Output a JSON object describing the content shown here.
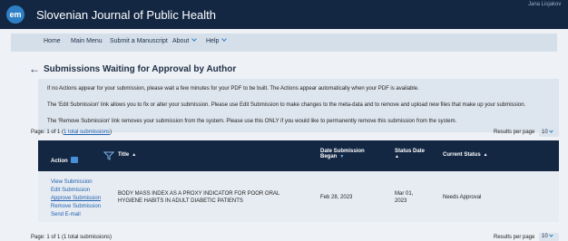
{
  "app": {
    "logo_text": "em",
    "journal_title": "Slovenian Journal of Public Health",
    "user_name": "Jana Lisjakov"
  },
  "nav": {
    "items": [
      {
        "label": "Home"
      },
      {
        "label": "Main Menu"
      },
      {
        "label": "Submit a Manuscript"
      },
      {
        "label": "About"
      },
      {
        "label": "Help"
      }
    ]
  },
  "page": {
    "back_arrow": "←",
    "title": "Submissions Waiting for Approval by Author"
  },
  "info": {
    "lines": [
      "If no Actions appear for your submission, please wait a few minutes for your PDF to be built. The Actions appear automatically when your PDF is available.",
      "The 'Edit Submission' link allows you to fix or alter your submission. Please use Edit Submission to make changes to the meta-data and to remove and upload new files that make up your submission.",
      "The 'Remove Submission' link removes your submission from the system. Please use this ONLY if you would like to permanently remove this submission from the system."
    ]
  },
  "pager": {
    "top_prefix": "Page: 1 of 1 (",
    "top_link": "1 total submissions",
    "top_suffix": ")",
    "bottom_text": "Page: 1 of 1 (1 total submissions)",
    "results_label": "Results per page",
    "results_value": "10"
  },
  "table": {
    "headers": {
      "action": "Action",
      "title": "Title",
      "date_submission_1": "Date Submission",
      "date_submission_2": "Began",
      "status_date_1": "Status Date",
      "current_status": "Current Status"
    },
    "row": {
      "actions": [
        "View Submission",
        "Edit Submission",
        "Approve Submission",
        "Remove Submission",
        "Send E-mail"
      ],
      "title_line1": "BODY MASS INDEX AS A PROXY INDICATOR FOR POOR ORAL",
      "title_line2": "HYGIENE HABITS IN ADULT DIABETIC PATIENTS",
      "date_began": "Feb 28, 2023",
      "status_date_1": "Mar 01,",
      "status_date_2": "2023",
      "current_status": "Needs Approval"
    }
  },
  "colors": {
    "header_bg": "#132743",
    "nav_bg": "#d4dfea",
    "accent": "#2f7fc6",
    "link": "#1f5fb0"
  }
}
